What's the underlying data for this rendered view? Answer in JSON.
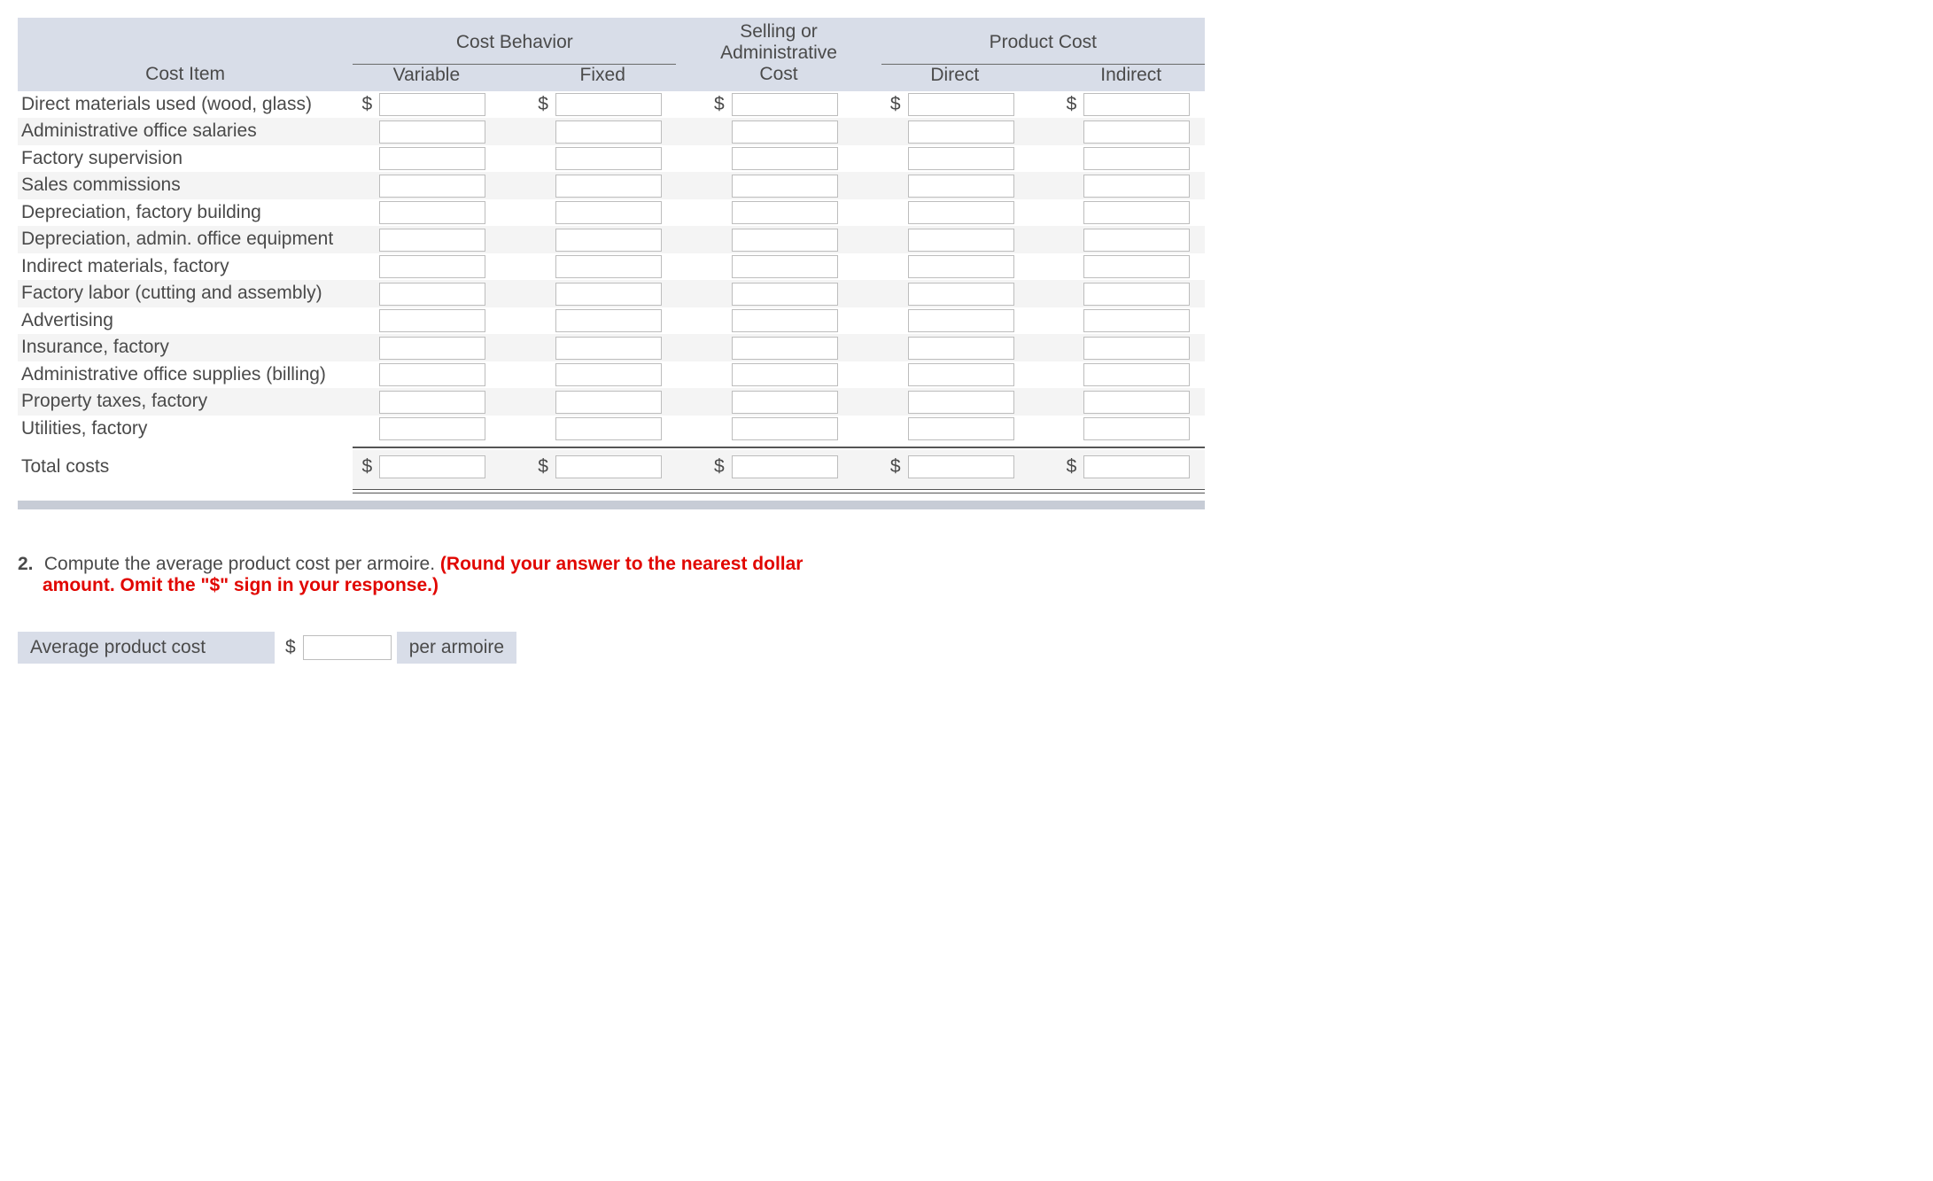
{
  "header": {
    "group1": "Cost Behavior",
    "group2": "Selling or\nAdministrative",
    "group3": "Product Cost",
    "col_item": "Cost Item",
    "col_variable": "Variable",
    "col_fixed": "Fixed",
    "col_cost": "Cost",
    "col_direct": "Direct",
    "col_indirect": "Indirect"
  },
  "currency": "$",
  "rows": [
    {
      "label": "Direct materials used (wood, glass)",
      "show_signs": true
    },
    {
      "label": "Administrative office salaries"
    },
    {
      "label": "Factory supervision"
    },
    {
      "label": "Sales commissions"
    },
    {
      "label": "Depreciation, factory building"
    },
    {
      "label": "Depreciation, admin. office equipment"
    },
    {
      "label": "Indirect materials, factory"
    },
    {
      "label": "Factory labor (cutting and assembly)"
    },
    {
      "label": "Advertising"
    },
    {
      "label": "Insurance, factory"
    },
    {
      "label": "Administrative office supplies (billing)"
    },
    {
      "label": "Property taxes, factory"
    },
    {
      "label": "Utilities, factory"
    }
  ],
  "totals": {
    "label": "Total costs"
  },
  "q2": {
    "number": "2.",
    "text_a": "Compute the average product cost per armoire. ",
    "red_a": "(Round your answer to the nearest dollar",
    "red_b": "amount. Omit the \"$\" sign in your response.)",
    "avg_label": "Average product cost",
    "avg_suffix": "per armoire"
  }
}
